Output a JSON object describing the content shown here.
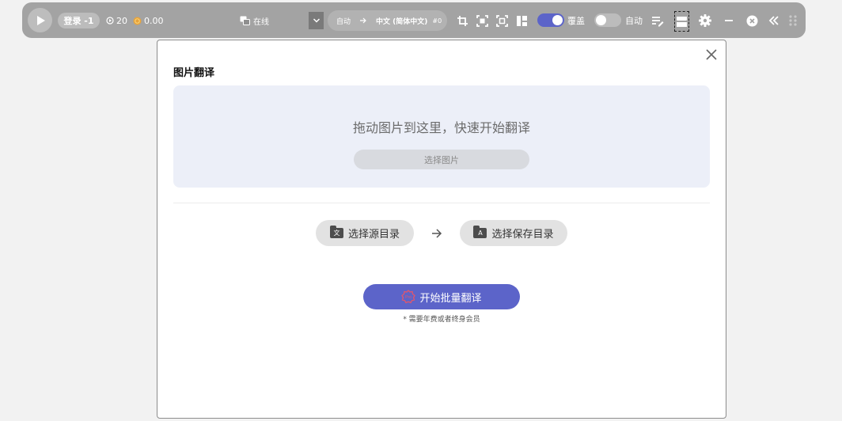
{
  "toolbar": {
    "login_label": "登录 -1",
    "play_count": "20",
    "coin_count": "0.00",
    "mode_label": "在线",
    "source_lang": "自动",
    "target_lang": "中文 (简体中文)",
    "target_badge": "#0",
    "overlay_label": "覆盖",
    "auto_label": "自动",
    "colors": {
      "bar": "#a3a3a3",
      "coin": "#e8a33a",
      "toggle_on": "#5c64c9"
    },
    "icons": [
      "play-icon",
      "logout-icon",
      "play-count-icon",
      "coin-icon",
      "translate-mode-icon",
      "chevron-down-icon",
      "arrow-right-icon",
      "crop-icon",
      "capture-icon",
      "capture-window-icon",
      "layout-icon",
      "edit-list-icon",
      "image-translate-icon",
      "gear-icon",
      "minimize-icon",
      "close-circle-icon",
      "collapse-icon",
      "drag-handle-icon"
    ]
  },
  "dialog": {
    "title": "图片翻译",
    "drop_text": "拖动图片到这里，快速开始翻译",
    "select_image_label": "选择图片",
    "source_dir_label": "选择源目录",
    "source_dir_glyph": "文",
    "save_dir_label": "选择保存目录",
    "save_dir_glyph": "A",
    "start_label": "开始批量翻译",
    "pro_badge": "Pro",
    "note": "* 需要年费或者终身会员",
    "colors": {
      "drop_bg": "#eceff8",
      "primary": "#5c64c9",
      "pro_badge": "#e3566b"
    }
  }
}
